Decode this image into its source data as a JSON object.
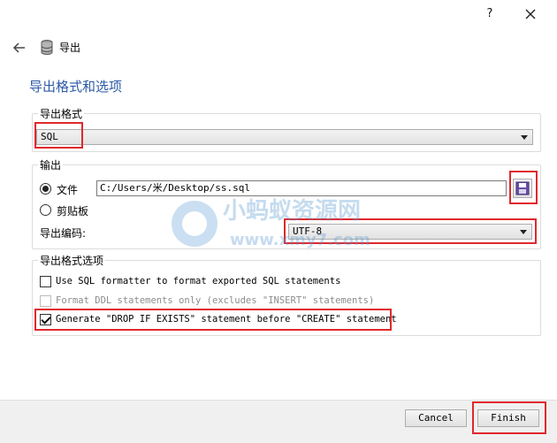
{
  "window": {
    "help_label": "?"
  },
  "header": {
    "title": "导出"
  },
  "section_title": "导出格式和选项",
  "format_group": {
    "legend": "导出格式",
    "selected": "SQL"
  },
  "output_group": {
    "legend": "输出",
    "file_label": "文件",
    "file_path": "C:/Users/米/Desktop/ss.sql",
    "clipboard_label": "剪贴板",
    "encoding_label": "导出编码:",
    "encoding_value": "UTF-8",
    "selected_output": "file"
  },
  "options_group": {
    "legend": "导出格式选项",
    "options": [
      {
        "label": "Use SQL formatter to format exported SQL statements",
        "checked": false,
        "enabled": true
      },
      {
        "label": "Format DDL statements only (excludes \"INSERT\" statements)",
        "checked": false,
        "enabled": false
      },
      {
        "label": "Generate \"DROP IF EXISTS\" statement before \"CREATE\" statement",
        "checked": true,
        "enabled": true
      }
    ]
  },
  "footer": {
    "cancel_label": "Cancel",
    "finish_label": "Finish"
  },
  "watermark": {
    "text_cn": "小蚂蚁资源网",
    "text_url": "www.xmy7.com"
  },
  "colors": {
    "accent_title": "#2e5aa8",
    "highlight_box": "#e0282c"
  }
}
